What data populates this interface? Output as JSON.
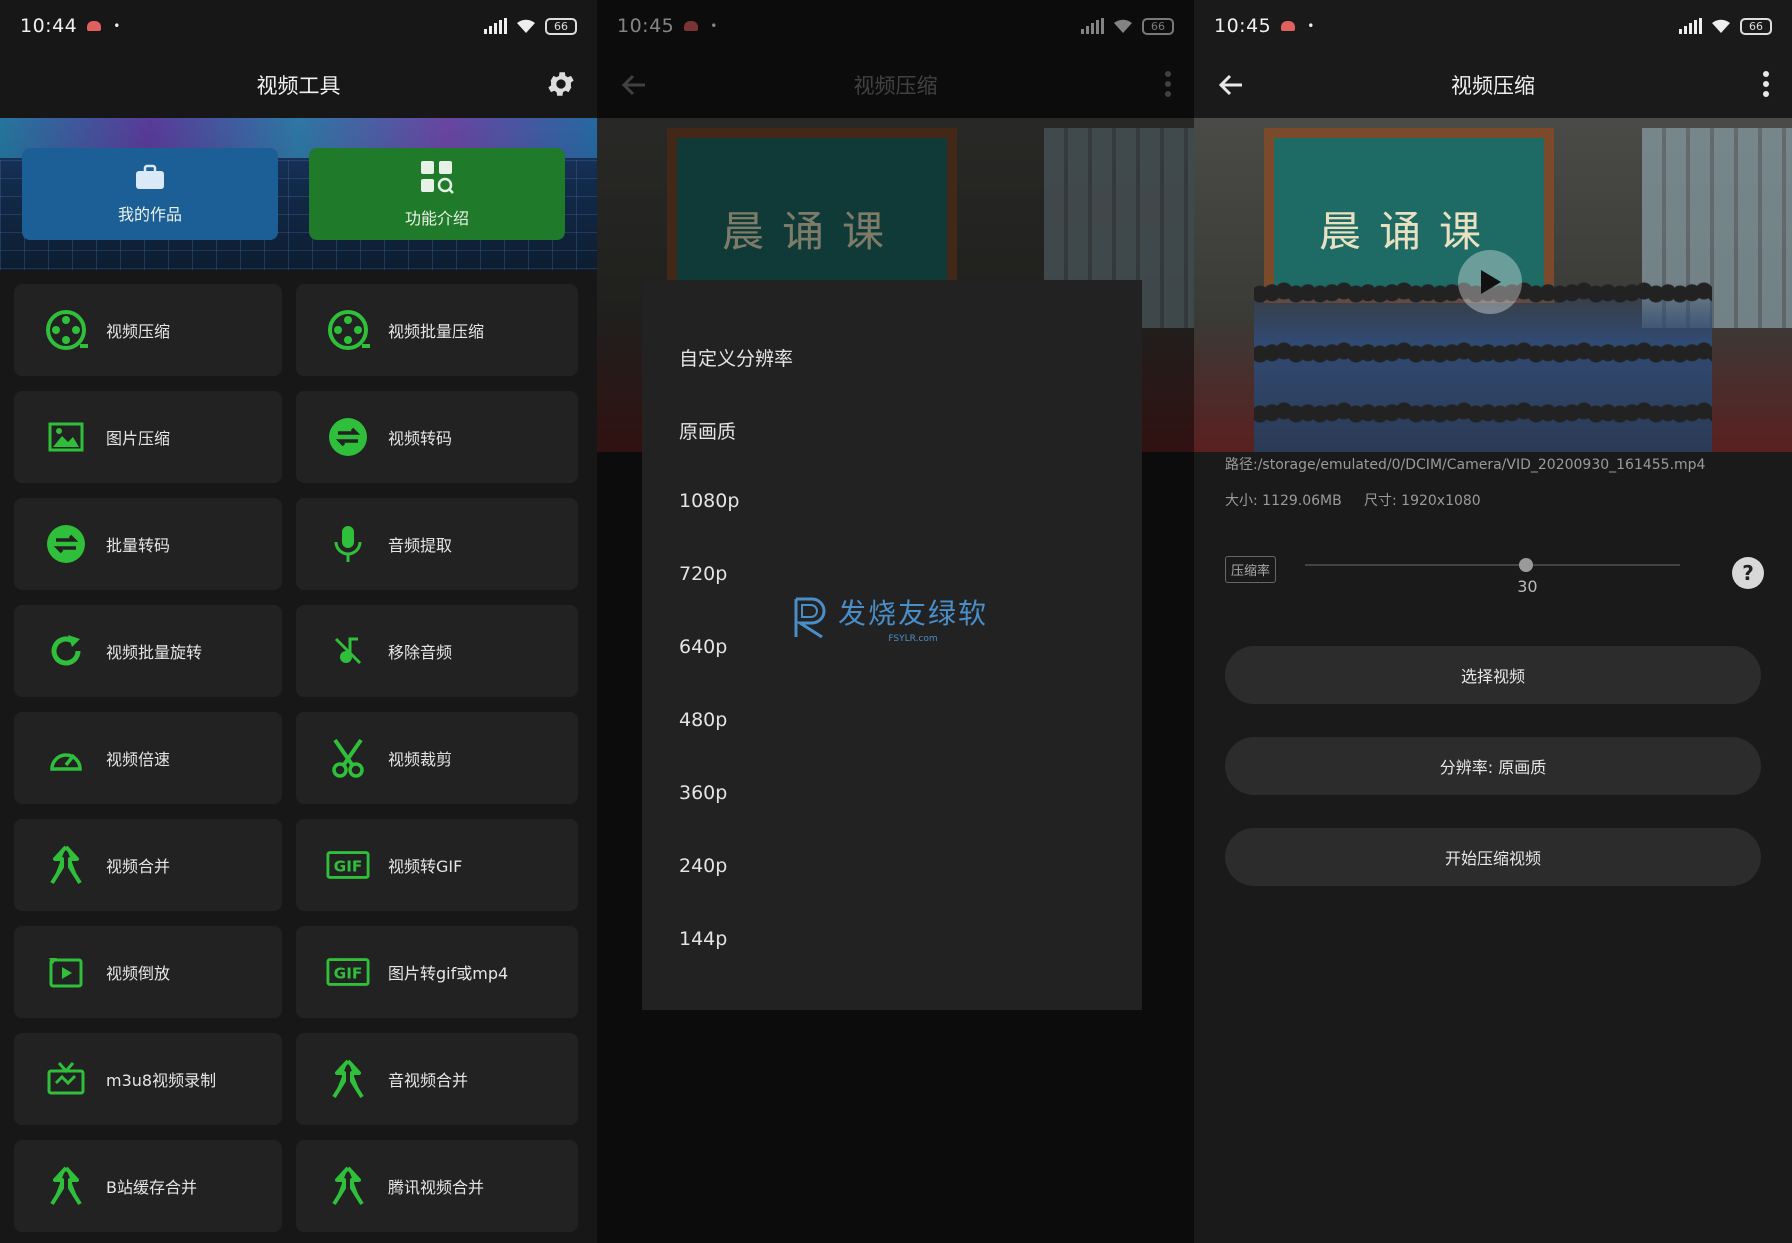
{
  "screen1": {
    "status": {
      "time": "10:44",
      "battery": "66"
    },
    "title": "视频工具",
    "banner": {
      "works_label": "我的作品",
      "features_label": "功能介绍"
    },
    "tools": [
      {
        "label": "视频压缩",
        "icon": "film-reel-icon"
      },
      {
        "label": "视频批量压缩",
        "icon": "film-reel-icon"
      },
      {
        "label": "图片压缩",
        "icon": "image-icon"
      },
      {
        "label": "视频转码",
        "icon": "swap-arrows-icon"
      },
      {
        "label": "批量转码",
        "icon": "swap-arrows-icon"
      },
      {
        "label": "音频提取",
        "icon": "microphone-icon"
      },
      {
        "label": "视频批量旋转",
        "icon": "rotate-icon"
      },
      {
        "label": "移除音频",
        "icon": "mute-note-icon"
      },
      {
        "label": "视频倍速",
        "icon": "speedometer-icon"
      },
      {
        "label": "视频裁剪",
        "icon": "scissors-icon"
      },
      {
        "label": "视频合并",
        "icon": "merge-icon"
      },
      {
        "label": "视频转GIF",
        "icon": "gif-icon"
      },
      {
        "label": "视频倒放",
        "icon": "reverse-play-icon"
      },
      {
        "label": "图片转gif或mp4",
        "icon": "gif-icon"
      },
      {
        "label": "m3u8视频录制",
        "icon": "tv-icon"
      },
      {
        "label": "音视频合并",
        "icon": "merge-icon"
      },
      {
        "label": "B站缓存合并",
        "icon": "merge-icon"
      },
      {
        "label": "腾讯视频合并",
        "icon": "merge-icon"
      }
    ]
  },
  "screen2": {
    "status": {
      "time": "10:45",
      "battery": "66"
    },
    "title": "视频压缩",
    "board_text": "晨诵课",
    "resolution_options": [
      "自定义分辨率",
      "原画质",
      "1080p",
      "720p",
      "640p",
      "480p",
      "360p",
      "240p",
      "144p"
    ],
    "watermark": {
      "text": "发烧友绿软",
      "sub": "FSYLR.com"
    }
  },
  "screen3": {
    "status": {
      "time": "10:45",
      "battery": "66"
    },
    "title": "视频压缩",
    "board_text": "晨诵课",
    "path": "路径:/storage/emulated/0/DCIM/Camera/VID_20200930_161455.mp4",
    "size": "大小: 1129.06MB",
    "dimensions": "尺寸: 1920x1080",
    "ratio_label": "压缩率",
    "ratio_value": "30",
    "ratio_fraction": 0.59,
    "help_label": "?",
    "select_video": "选择视频",
    "resolution": "分辨率: 原画质",
    "start": "开始压缩视频"
  },
  "colors": {
    "accent_green": "#2fbf3a",
    "card_bg": "#222222",
    "blue_card": "#1c5f96",
    "green_card": "#1f7a2a"
  }
}
